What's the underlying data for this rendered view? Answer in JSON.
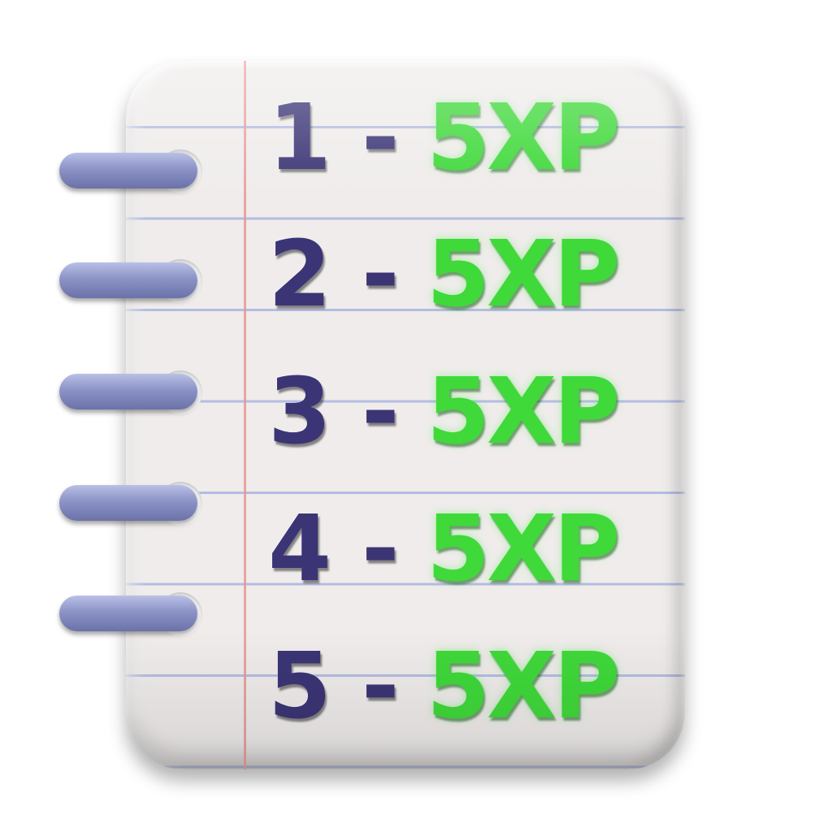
{
  "rows": [
    {
      "number": "1",
      "dash": "-",
      "reward": "5XP"
    },
    {
      "number": "2",
      "dash": "-",
      "reward": "5XP"
    },
    {
      "number": "3",
      "dash": "-",
      "reward": "5XP"
    },
    {
      "number": "4",
      "dash": "-",
      "reward": "5XP"
    },
    {
      "number": "5",
      "dash": "-",
      "reward": "5XP"
    }
  ],
  "colors": {
    "number": "#3b3575",
    "reward": "#3fd93a",
    "paper": "#efeceb",
    "rule_line": "#aab4e1",
    "margin_line": "#e89696",
    "ring": "#8c93c6"
  },
  "icon": "spiral-notebook-icon"
}
